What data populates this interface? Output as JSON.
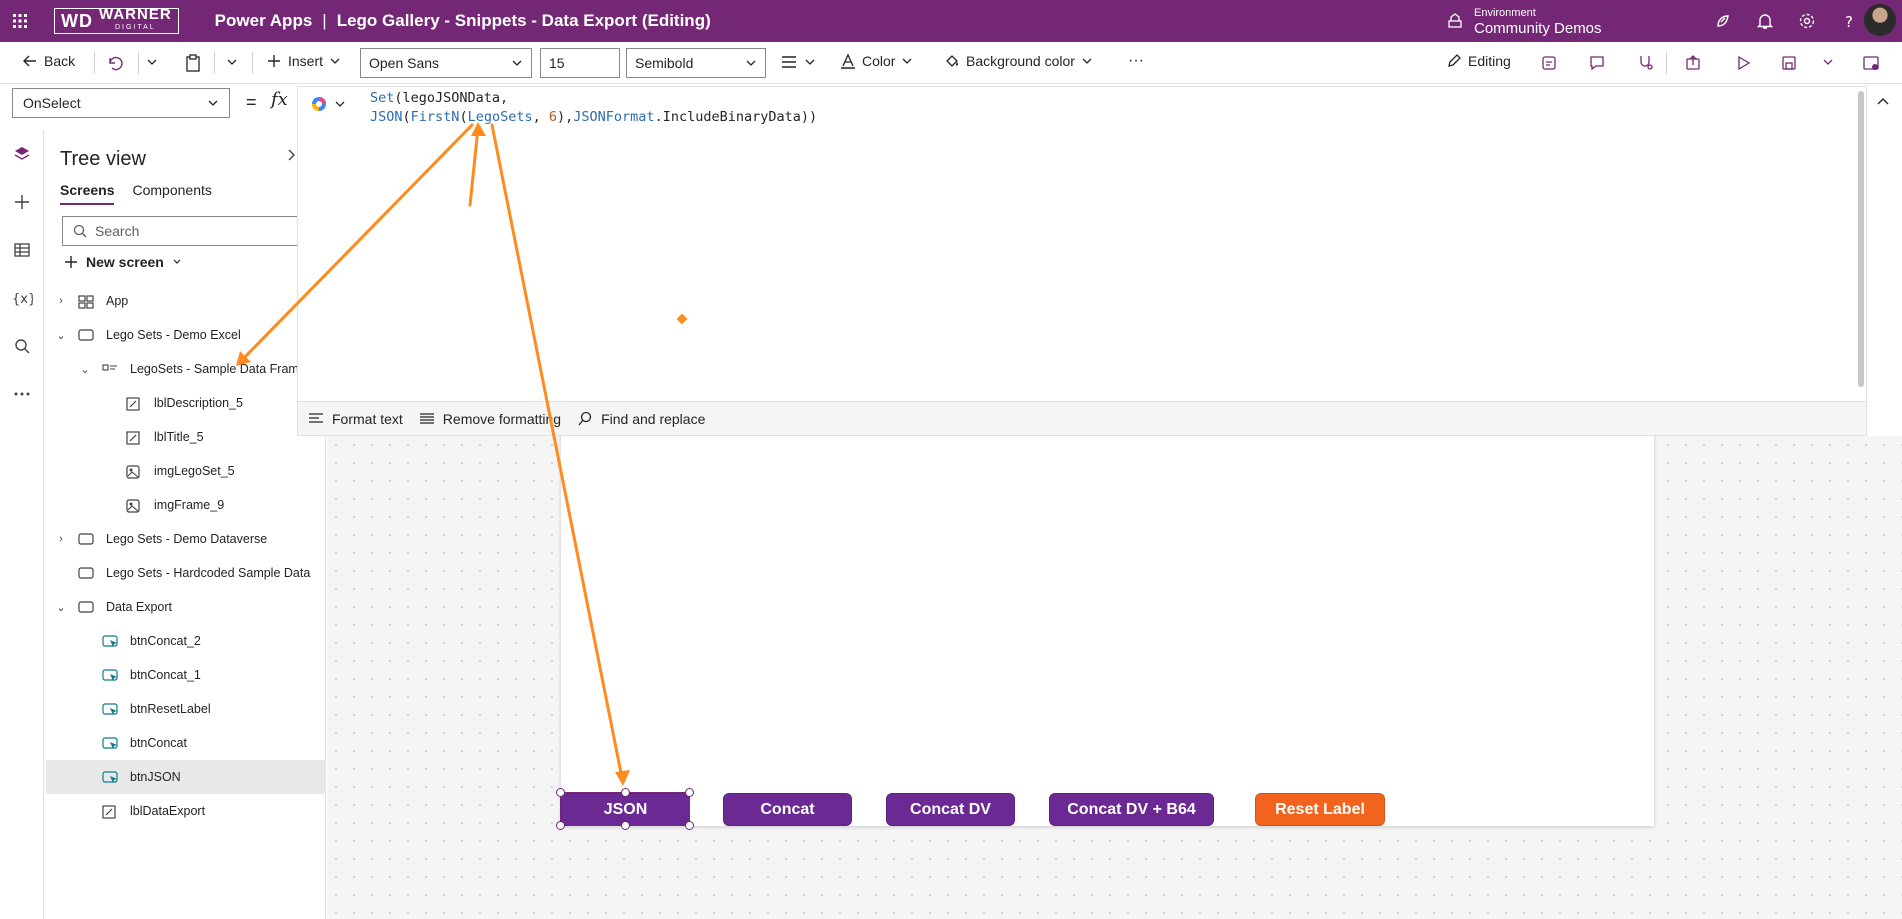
{
  "topbar": {
    "logo_wd": "WD",
    "logo_name": "WARNER",
    "logo_sub": "DIGITAL",
    "app_name": "Power Apps",
    "separator": "|",
    "doc_title": "Lego Gallery - Snippets - Data Export (Editing)",
    "env_label": "Environment",
    "env_name": "Community Demos"
  },
  "command_bar": {
    "back": "Back",
    "insert": "Insert",
    "font": "Open Sans",
    "font_size": "15",
    "font_weight": "Semibold",
    "color": "Color",
    "background_color": "Background color",
    "more": "···",
    "editing": "Editing"
  },
  "formula_bar": {
    "property": "OnSelect",
    "equals": "=",
    "fx": "fx",
    "line1": {
      "fn": "Set",
      "rest": "(legoJSONData,"
    },
    "line2": {
      "fn1": "JSON",
      "p1": "(",
      "fn2": "FirstN",
      "p2": "(",
      "var": "LegoSets",
      "comma": ", ",
      "num": "6",
      "p3": "),",
      "enum": "JSONFormat",
      "rest": ".IncludeBinaryData))"
    },
    "footer": {
      "format_text": "Format text",
      "remove_formatting": "Remove formatting",
      "find_replace": "Find and replace"
    }
  },
  "tree": {
    "title": "Tree view",
    "tabs": [
      "Screens",
      "Components"
    ],
    "search_placeholder": "Search",
    "new_screen": "New screen",
    "items": [
      {
        "label": "App",
        "chev": "›",
        "icon": "app-icon"
      },
      {
        "label": "Lego Sets - Demo Excel",
        "chev": "⌄",
        "icon": "screen-icon"
      },
      {
        "label": "LegoSets - Sample Data Frame",
        "chev": "⌄",
        "icon": "gallery-icon"
      },
      {
        "label": "lblDescription_5",
        "chev": "",
        "icon": "label-icon"
      },
      {
        "label": "lblTitle_5",
        "chev": "",
        "icon": "label-icon"
      },
      {
        "label": "imgLegoSet_5",
        "chev": "",
        "icon": "image-icon"
      },
      {
        "label": "imgFrame_9",
        "chev": "",
        "icon": "image-icon"
      },
      {
        "label": "Lego Sets - Demo Dataverse",
        "chev": "›",
        "icon": "screen-icon"
      },
      {
        "label": "Lego Sets - Hardcoded Sample Data",
        "chev": "",
        "icon": "screen-icon"
      },
      {
        "label": "Data Export",
        "chev": "⌄",
        "icon": "screen-icon"
      },
      {
        "label": "btnConcat_2",
        "chev": "",
        "icon": "button-icon"
      },
      {
        "label": "btnConcat_1",
        "chev": "",
        "icon": "button-icon"
      },
      {
        "label": "btnResetLabel",
        "chev": "",
        "icon": "button-icon"
      },
      {
        "label": "btnConcat",
        "chev": "",
        "icon": "button-icon"
      },
      {
        "label": "btnJSON",
        "chev": "",
        "icon": "button-icon"
      },
      {
        "label": "lblDataExport",
        "chev": "",
        "icon": "label-icon"
      }
    ]
  },
  "canvas": {
    "buttons": [
      {
        "label": "JSON",
        "color": "#6b2a93"
      },
      {
        "label": "Concat",
        "color": "#6b2a93"
      },
      {
        "label": "Concat DV",
        "color": "#6b2a93"
      },
      {
        "label": "Concat DV + B64",
        "color": "#6b2a93"
      },
      {
        "label": "Reset Label",
        "color": "#f2641e"
      }
    ]
  },
  "colors": {
    "brand": "#742774",
    "annotation": "#ff8a1d"
  }
}
